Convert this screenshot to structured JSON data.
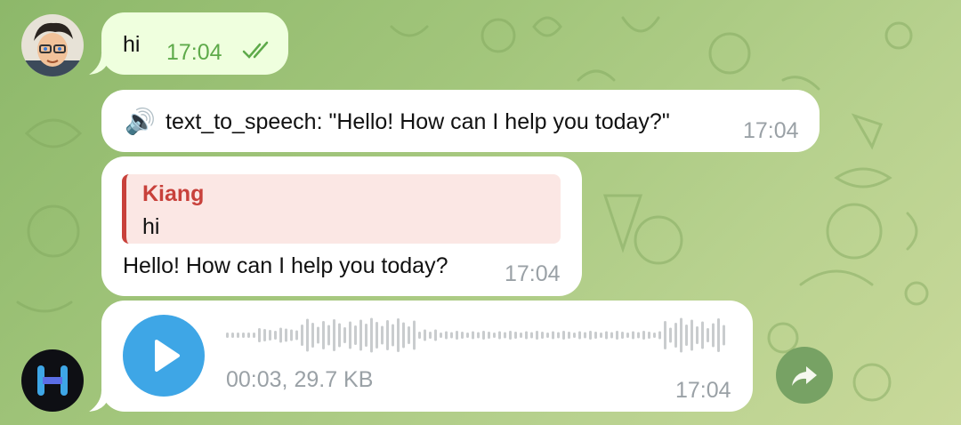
{
  "colors": {
    "outgoing_bubble": "#efffde",
    "incoming_bubble": "#ffffff",
    "outgoing_time": "#5eaa4a",
    "incoming_time": "#9aa1a6",
    "reply_accent": "#c8413b",
    "reply_bg": "#fbe7e4",
    "play_button": "#3ea6e6",
    "waveform": "#c9ccce",
    "forward_button": "#6b9a5c"
  },
  "messages": {
    "outgoing": {
      "text": "hi",
      "time": "17:04",
      "status_icon": "double-check-icon"
    },
    "tts": {
      "icon": "speaker-icon",
      "text": "text_to_speech: \"Hello! How can I help you today?\"",
      "time": "17:04"
    },
    "reply": {
      "quote_author": "Kiang",
      "quote_text": "hi",
      "text": "Hello! How can I help you today?",
      "time": "17:04"
    },
    "voice": {
      "icon": "play-icon",
      "meta": "00:03, 29.7 KB",
      "time": "17:04"
    }
  },
  "avatars": {
    "user": "user-avatar",
    "bot": "bot-avatar"
  },
  "actions": {
    "forward_icon": "share-arrow-icon"
  }
}
